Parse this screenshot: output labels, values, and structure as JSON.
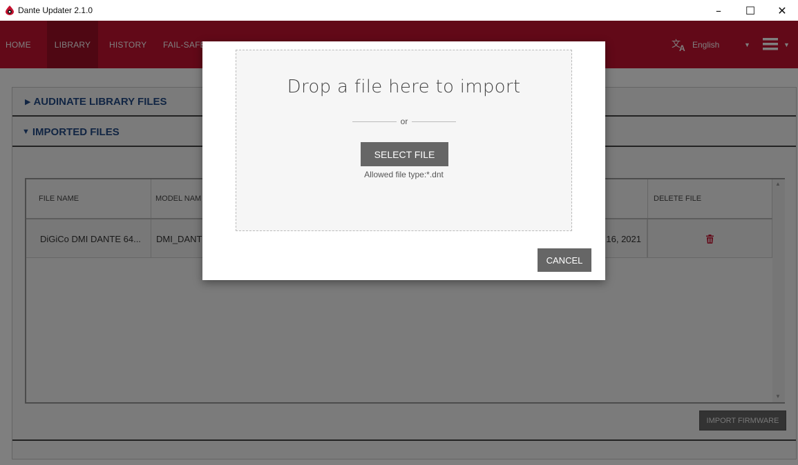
{
  "window": {
    "title": "Dante Updater 2.1.0",
    "minimize": "–",
    "maximize": "☐",
    "close": "✕"
  },
  "nav": {
    "items": [
      "HOME",
      "LIBRARY",
      "HISTORY",
      "FAIL-SAFE"
    ],
    "active": "LIBRARY",
    "language": "English",
    "language_icon": "translate-icon",
    "menu_icon": "hamburger-menu-icon"
  },
  "library": {
    "sections": [
      "AUDINATE LIBRARY FILES",
      "IMPORTED FILES"
    ],
    "table": {
      "columns": [
        "FILE NAME",
        "MODEL NAM",
        "DELETE FILE"
      ],
      "rows": [
        {
          "file_name": "DiGiCo DMI DANTE 64...",
          "model_name": "DMI_DANT",
          "date": "16, 2021"
        }
      ]
    },
    "import_button": "IMPORT FIRMWARE"
  },
  "modal": {
    "title": "Drop a file here to import",
    "or": "or",
    "select_button": "SELECT FILE",
    "allowed": "Allowed file type:*.dnt",
    "cancel_button": "CANCEL"
  },
  "colors": {
    "nav_bg": "#c41230",
    "nav_active_bg": "#9e0e27",
    "section_text": "#234a86",
    "button_bg": "#666666"
  }
}
